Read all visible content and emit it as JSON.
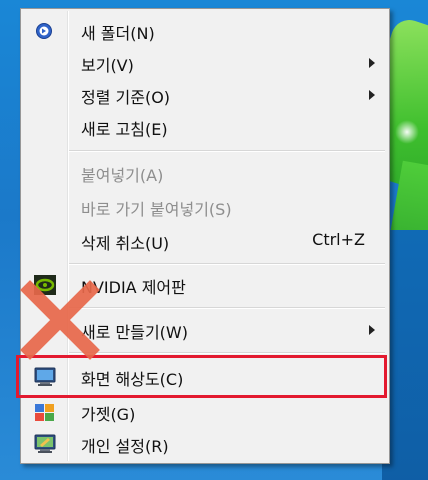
{
  "menu": {
    "items": [
      {
        "label": "새 폴더(N)",
        "icon": "new-folder-icon",
        "submenu": false,
        "disabled": false
      },
      {
        "label": "보기(V)",
        "submenu": true,
        "disabled": false
      },
      {
        "label": "정렬 기준(O)",
        "submenu": true,
        "disabled": false
      },
      {
        "label": "새로 고침(E)",
        "submenu": false,
        "disabled": false
      },
      {
        "label": "붙여넣기(A)",
        "submenu": false,
        "disabled": true
      },
      {
        "label": "바로 가기 붙여넣기(S)",
        "submenu": false,
        "disabled": true
      },
      {
        "label": "삭제 취소(U)",
        "shortcut": "Ctrl+Z",
        "submenu": false,
        "disabled": false
      },
      {
        "label": "NVIDIA 제어판",
        "icon": "nvidia-icon",
        "submenu": false,
        "disabled": false
      },
      {
        "label": "새로 만들기(W)",
        "submenu": true,
        "disabled": false
      },
      {
        "label": "화면 해상도(C)",
        "icon": "display-icon",
        "submenu": false,
        "disabled": false,
        "highlighted": true
      },
      {
        "label": "가젯(G)",
        "icon": "gadgets-icon",
        "submenu": false,
        "disabled": false
      },
      {
        "label": "개인 설정(R)",
        "icon": "personalize-icon",
        "submenu": false,
        "disabled": false
      }
    ]
  },
  "colors": {
    "highlight_box": "#e3192f",
    "x_mark": "#e8684a",
    "menu_bg": "#f1f1f1",
    "disabled_text": "#8e8e8e"
  }
}
